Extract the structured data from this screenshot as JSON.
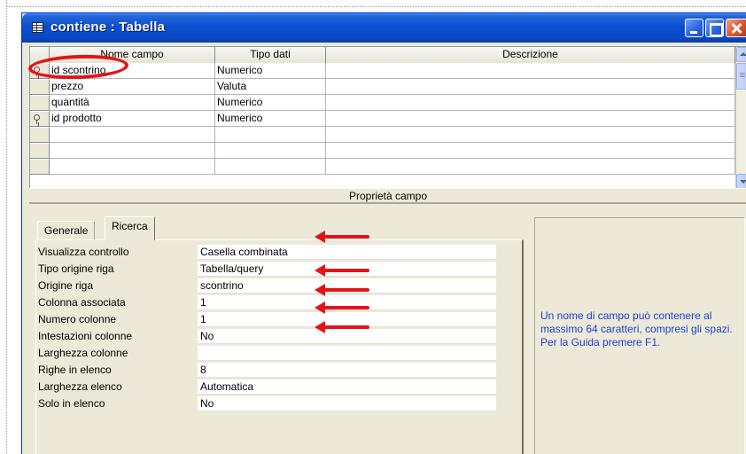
{
  "window": {
    "title": "contiene : Tabella"
  },
  "grid": {
    "headers": [
      "Nome campo",
      "Tipo dati",
      "Descrizione"
    ],
    "rows": [
      {
        "name": "id scontrino",
        "type": "Numerico",
        "description": "",
        "key": true
      },
      {
        "name": "prezzo",
        "type": "Valuta",
        "description": "",
        "key": false
      },
      {
        "name": "quantità",
        "type": "Numerico",
        "description": "",
        "key": false
      },
      {
        "name": "id prodotto",
        "type": "Numerico",
        "description": "",
        "key": true
      },
      {
        "name": "",
        "type": "",
        "description": "",
        "key": false
      },
      {
        "name": "",
        "type": "",
        "description": "",
        "key": false
      },
      {
        "name": "",
        "type": "",
        "description": "",
        "key": false
      }
    ]
  },
  "properties": {
    "section_title": "Proprietà campo",
    "tabs": [
      "Generale",
      "Ricerca"
    ],
    "active_tab": "Ricerca",
    "rows": [
      {
        "label": "Visualizza controllo",
        "value": "Casella combinata"
      },
      {
        "label": "Tipo origine riga",
        "value": "Tabella/query"
      },
      {
        "label": "Origine riga",
        "value": "scontrino"
      },
      {
        "label": "Colonna associata",
        "value": "1"
      },
      {
        "label": "Numero colonne",
        "value": "1"
      },
      {
        "label": "Intestazioni colonne",
        "value": "No"
      },
      {
        "label": "Larghezza colonne",
        "value": ""
      },
      {
        "label": "Righe in elenco",
        "value": "8"
      },
      {
        "label": "Larghezza elenco",
        "value": "Automatica"
      },
      {
        "label": "Solo in elenco",
        "value": "No"
      }
    ],
    "help_text": "Un nome di campo può contenere al massimo 64 caratteri, compresi gli spazi. Per la Guida premere F1."
  },
  "annotations": {
    "color": "#e31419"
  },
  "colors": {
    "titlebar": "#0a4fd1",
    "help_text": "#1f3fd1",
    "window_bg": "#ece9d8"
  },
  "icons": [
    "table-icon",
    "minimize-icon",
    "maximize-icon",
    "close-icon",
    "primary-key-icon"
  ]
}
